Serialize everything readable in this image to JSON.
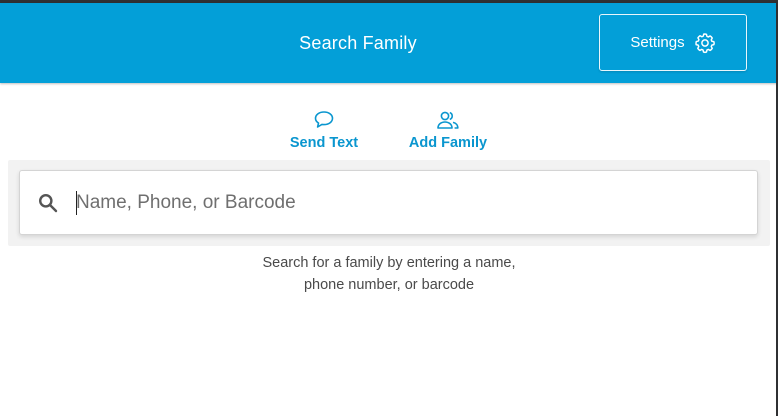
{
  "header": {
    "title": "Search Family",
    "settings_label": "Settings",
    "settings_icon": "gear-icon",
    "background_color": "#039fd8"
  },
  "actions": [
    {
      "label": "Send Text",
      "icon": "speech-bubble-icon"
    },
    {
      "label": "Add Family",
      "icon": "people-icon"
    }
  ],
  "search": {
    "placeholder": "Name, Phone, or Barcode",
    "value": "",
    "icon": "search-icon"
  },
  "help": {
    "line1": "Search for a family by entering a name,",
    "line2": "phone number, or barcode"
  },
  "colors": {
    "accent": "#039fd8",
    "link": "#0a96cf"
  }
}
